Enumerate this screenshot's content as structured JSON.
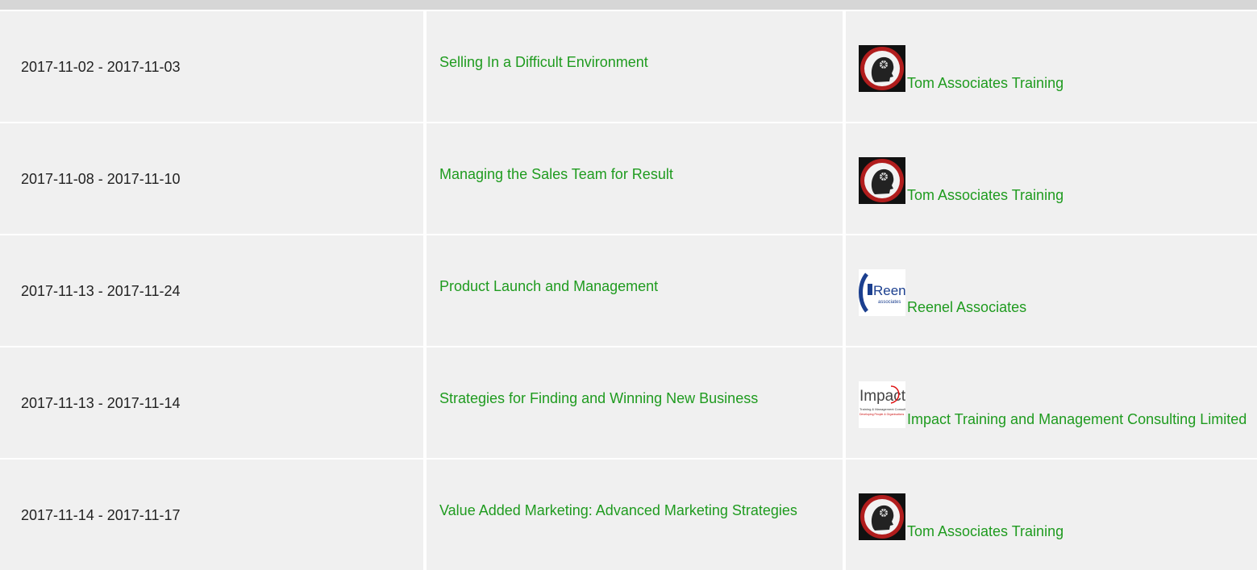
{
  "colors": {
    "link": "#1f9b1f",
    "header_title": "#e8141b",
    "header_bg": "#d6d6d6",
    "cell_bg": "#f0f0f0"
  },
  "rows": [
    {
      "dates": "2017-11-02 - 2017-11-03",
      "title": "Selling In a Difficult Environment",
      "provider": "Tom Associates Training",
      "logo": "tom-associates-logo"
    },
    {
      "dates": "2017-11-08 - 2017-11-10",
      "title": "Managing the Sales Team for Result",
      "provider": "Tom Associates Training",
      "logo": "tom-associates-logo"
    },
    {
      "dates": "2017-11-13 - 2017-11-24",
      "title": "Product Launch and Management",
      "provider": "Reenel Associates",
      "logo": "reenel-associates-logo",
      "logo_text": "Reenel",
      "logo_subtext": "associates"
    },
    {
      "dates": "2017-11-13 - 2017-11-14",
      "title": "Strategies for Finding and Winning New Business",
      "provider": "Impact Training and Management Consulting Limited",
      "logo": "impact-training-logo",
      "logo_text": "Impact",
      "logo_subtext": "Training & Management Consulting",
      "logo_tagline": "Developing People & Organisations"
    },
    {
      "dates": "2017-11-14 - 2017-11-17",
      "title": "Value Added Marketing: Advanced Marketing Strategies",
      "provider": "Tom Associates Training",
      "logo": "tom-associates-logo"
    }
  ]
}
